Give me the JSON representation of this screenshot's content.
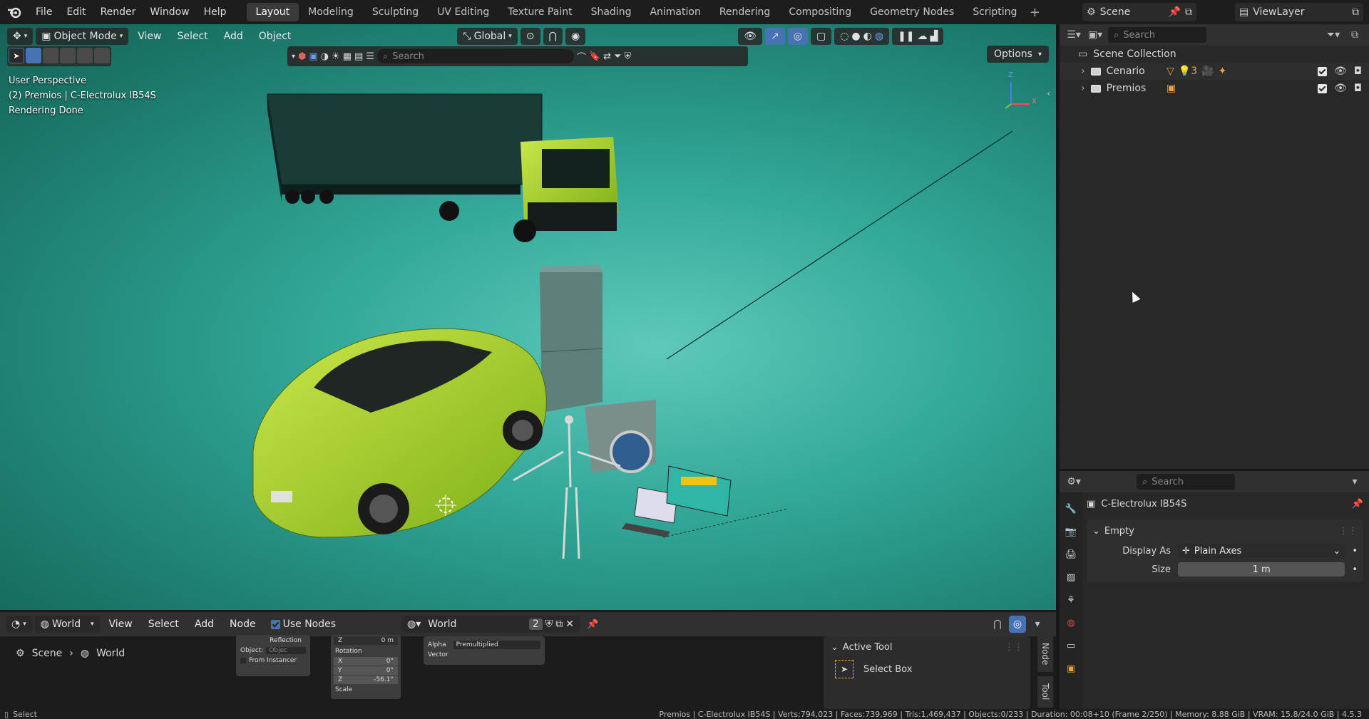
{
  "topbar": {
    "menus": [
      "File",
      "Edit",
      "Render",
      "Window",
      "Help"
    ],
    "workspaces": [
      "Layout",
      "Modeling",
      "Sculpting",
      "UV Editing",
      "Texture Paint",
      "Shading",
      "Animation",
      "Rendering",
      "Compositing",
      "Geometry Nodes",
      "Scripting"
    ],
    "active_workspace": "Layout",
    "scene_name": "Scene",
    "view_layer": "ViewLayer"
  },
  "viewport": {
    "mode": "Object Mode",
    "menus": [
      "View",
      "Select",
      "Add",
      "Object"
    ],
    "transform_orientation": "Global",
    "search_placeholder": "Search",
    "options_label": "Options",
    "overlay_lines": [
      "User Perspective",
      "(2) Premios | C-Electrolux IB54S",
      "Rendering Done"
    ],
    "axis_labels": {
      "z": "Z",
      "x": "X"
    }
  },
  "outliner": {
    "search_placeholder": "Search",
    "root": "Scene Collection",
    "collections": [
      {
        "name": "Cenario",
        "badges": [
          "▽",
          "💡3",
          "🎥",
          "✦"
        ]
      },
      {
        "name": "Premios",
        "badges": [
          "▣"
        ]
      }
    ]
  },
  "properties": {
    "search_placeholder": "Search",
    "object_name": "C-Electrolux IB54S",
    "panel_title": "Empty",
    "display_as_label": "Display As",
    "display_as_value": "Plain Axes",
    "size_label": "Size",
    "size_value": "1 m"
  },
  "node_editor": {
    "type_label": "World",
    "menus": [
      "View",
      "Select",
      "Add",
      "Node"
    ],
    "use_nodes_label": "Use Nodes",
    "datablock_name": "World",
    "users_count": "2",
    "breadcrumb": [
      "Scene",
      "World"
    ],
    "node_texts": {
      "reflection": "Reflection",
      "object": "Object:",
      "object_placeholder": "Objec",
      "from_instancer": "From Instancer",
      "z_top": "Z",
      "z_top_val": "0 m",
      "rotation": "Rotation",
      "rx": "X",
      "rx_val": "0°",
      "ry": "Y",
      "ry_val": "0°",
      "rz": "Z",
      "rz_val": "-56.1°",
      "scale": "Scale",
      "alpha": "Alpha",
      "alpha_val": "Premultiplied",
      "vector": "Vector"
    },
    "active_tool_title": "Active Tool",
    "active_tool_name": "Select Box",
    "side_tab_node": "Node",
    "side_tab_tool": "Tool"
  },
  "status": {
    "left": "Select",
    "right": "Premios | C-Electrolux IB54S | Verts:794,023 | Faces:739,969 | Tris:1,469,437 | Objects:0/233 | Duration: 00:08+10 (Frame 2/250) | Memory: 8.88 GiB | VRAM: 15.8/24.0 GiB | 4.5.3"
  },
  "colors": {
    "accent": "#4772b3",
    "lime": "#a8d62a",
    "teal": "#2ea596"
  }
}
